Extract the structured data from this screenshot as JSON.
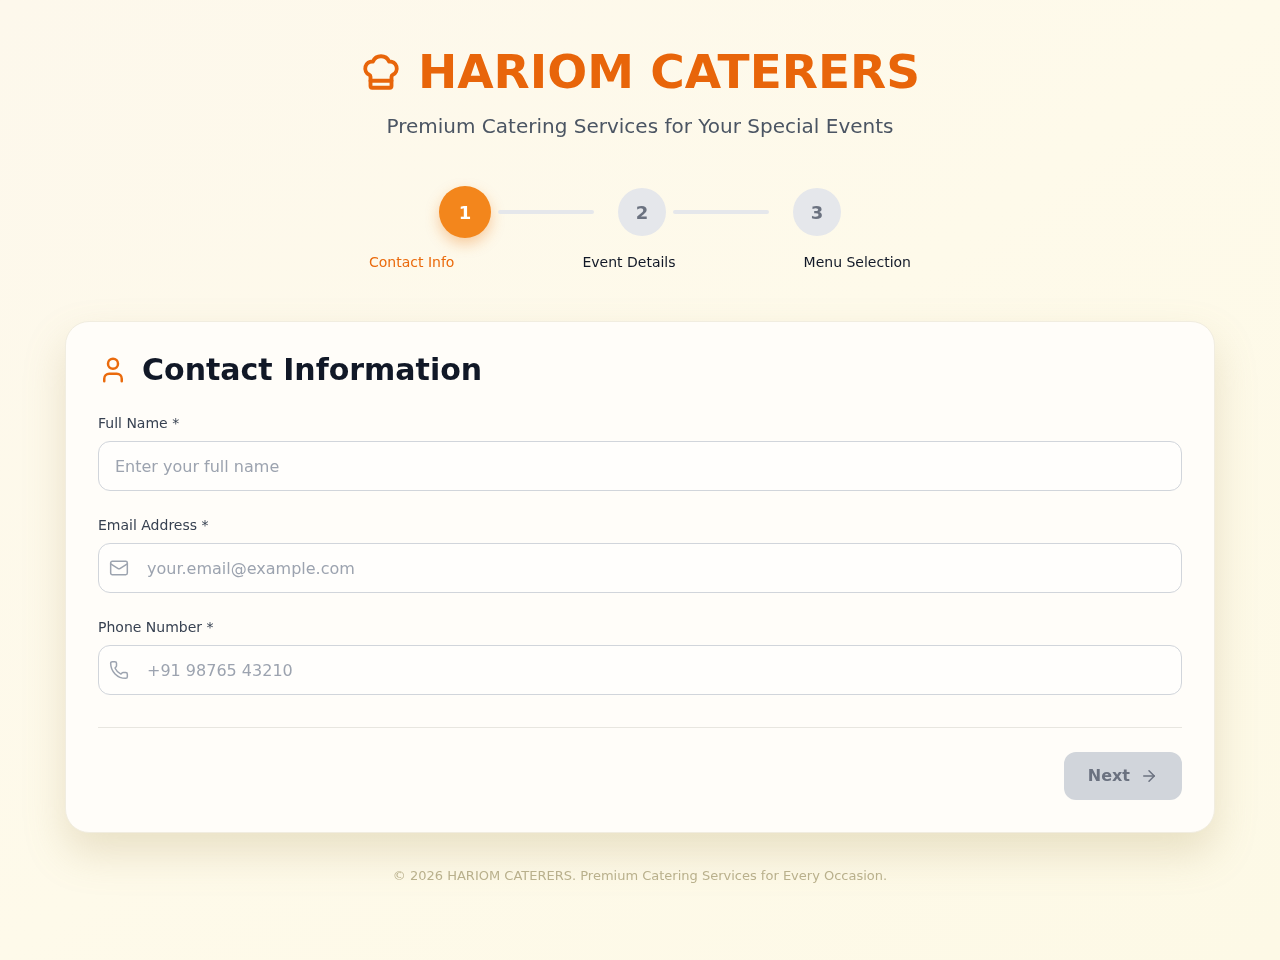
{
  "header": {
    "title": "HARIOM CATERERS",
    "subtitle": "Premium Catering Services for Your Special Events"
  },
  "steps": [
    {
      "number": "1",
      "label": "Contact Info",
      "selected": true
    },
    {
      "number": "2",
      "label": "Event Details",
      "selected": false
    },
    {
      "number": "3",
      "label": "Menu Selection",
      "selected": false
    }
  ],
  "form": {
    "title": "Contact Information",
    "fields": [
      {
        "kind": "text",
        "label": "Full Name *",
        "placeholder": "Enter your full name"
      },
      {
        "kind": "email",
        "label": "Email Address *",
        "placeholder": "your.email@example.com"
      },
      {
        "kind": "phone",
        "label": "Phone Number *",
        "placeholder": "+91 98765 43210"
      }
    ],
    "next_button": {
      "label": "Next",
      "disabled": true
    }
  },
  "footer": "© 2026 HARIOM CATERERS. Premium Catering Services for Every Occasion."
}
